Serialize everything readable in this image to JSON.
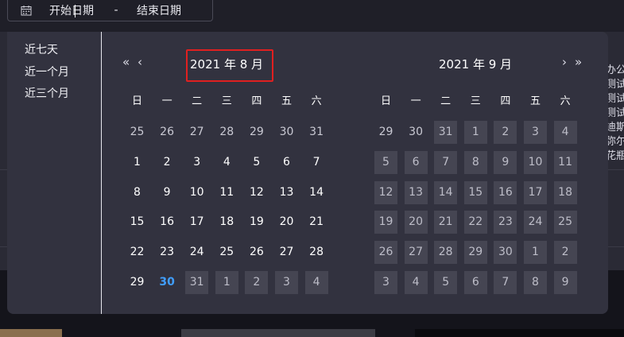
{
  "range_input": {
    "start_placeholder": "开始日期",
    "separator": "-",
    "end_placeholder": "结束日期",
    "icon": "calendar-icon"
  },
  "shortcuts": [
    "近七天",
    "近一个月",
    "近三个月"
  ],
  "weekdays": [
    "日",
    "一",
    "二",
    "三",
    "四",
    "五",
    "六"
  ],
  "left_month": {
    "title": "2021 年 8 月",
    "prev_year_icon": "«",
    "prev_month_icon": "‹",
    "weeks": [
      [
        {
          "d": "25",
          "t": "other"
        },
        {
          "d": "26",
          "t": "other"
        },
        {
          "d": "27",
          "t": "other"
        },
        {
          "d": "28",
          "t": "other"
        },
        {
          "d": "29",
          "t": "other"
        },
        {
          "d": "30",
          "t": "other"
        },
        {
          "d": "31",
          "t": "other"
        }
      ],
      [
        {
          "d": "1",
          "t": "cur"
        },
        {
          "d": "2",
          "t": "cur"
        },
        {
          "d": "3",
          "t": "cur"
        },
        {
          "d": "4",
          "t": "cur"
        },
        {
          "d": "5",
          "t": "cur"
        },
        {
          "d": "6",
          "t": "cur"
        },
        {
          "d": "7",
          "t": "cur"
        }
      ],
      [
        {
          "d": "8",
          "t": "cur"
        },
        {
          "d": "9",
          "t": "cur"
        },
        {
          "d": "10",
          "t": "cur"
        },
        {
          "d": "11",
          "t": "cur"
        },
        {
          "d": "12",
          "t": "cur"
        },
        {
          "d": "13",
          "t": "cur"
        },
        {
          "d": "14",
          "t": "cur"
        }
      ],
      [
        {
          "d": "15",
          "t": "cur"
        },
        {
          "d": "16",
          "t": "cur"
        },
        {
          "d": "17",
          "t": "cur"
        },
        {
          "d": "18",
          "t": "cur"
        },
        {
          "d": "19",
          "t": "cur"
        },
        {
          "d": "20",
          "t": "cur"
        },
        {
          "d": "21",
          "t": "cur"
        }
      ],
      [
        {
          "d": "22",
          "t": "cur"
        },
        {
          "d": "23",
          "t": "cur"
        },
        {
          "d": "24",
          "t": "cur"
        },
        {
          "d": "25",
          "t": "cur"
        },
        {
          "d": "26",
          "t": "cur"
        },
        {
          "d": "27",
          "t": "cur"
        },
        {
          "d": "28",
          "t": "cur"
        }
      ],
      [
        {
          "d": "29",
          "t": "cur"
        },
        {
          "d": "30",
          "t": "today"
        },
        {
          "d": "31",
          "t": "disabled"
        },
        {
          "d": "1",
          "t": "disabled"
        },
        {
          "d": "2",
          "t": "disabled"
        },
        {
          "d": "3",
          "t": "disabled"
        },
        {
          "d": "4",
          "t": "disabled"
        }
      ]
    ]
  },
  "right_month": {
    "title": "2021 年 9 月",
    "next_month_icon": "›",
    "next_year_icon": "»",
    "weeks": [
      [
        {
          "d": "29",
          "t": "other"
        },
        {
          "d": "30",
          "t": "other"
        },
        {
          "d": "31",
          "t": "disabled"
        },
        {
          "d": "1",
          "t": "disabled"
        },
        {
          "d": "2",
          "t": "disabled"
        },
        {
          "d": "3",
          "t": "disabled"
        },
        {
          "d": "4",
          "t": "disabled"
        }
      ],
      [
        {
          "d": "5",
          "t": "disabled"
        },
        {
          "d": "6",
          "t": "disabled"
        },
        {
          "d": "7",
          "t": "disabled"
        },
        {
          "d": "8",
          "t": "disabled"
        },
        {
          "d": "9",
          "t": "disabled"
        },
        {
          "d": "10",
          "t": "disabled"
        },
        {
          "d": "11",
          "t": "disabled"
        }
      ],
      [
        {
          "d": "12",
          "t": "disabled"
        },
        {
          "d": "13",
          "t": "disabled"
        },
        {
          "d": "14",
          "t": "disabled"
        },
        {
          "d": "15",
          "t": "disabled"
        },
        {
          "d": "16",
          "t": "disabled"
        },
        {
          "d": "17",
          "t": "disabled"
        },
        {
          "d": "18",
          "t": "disabled"
        }
      ],
      [
        {
          "d": "19",
          "t": "disabled"
        },
        {
          "d": "20",
          "t": "disabled"
        },
        {
          "d": "21",
          "t": "disabled"
        },
        {
          "d": "22",
          "t": "disabled"
        },
        {
          "d": "23",
          "t": "disabled"
        },
        {
          "d": "24",
          "t": "disabled"
        },
        {
          "d": "25",
          "t": "disabled"
        }
      ],
      [
        {
          "d": "26",
          "t": "disabled"
        },
        {
          "d": "27",
          "t": "disabled"
        },
        {
          "d": "28",
          "t": "disabled"
        },
        {
          "d": "29",
          "t": "disabled"
        },
        {
          "d": "30",
          "t": "disabled"
        },
        {
          "d": "1",
          "t": "disabled"
        },
        {
          "d": "2",
          "t": "disabled"
        }
      ],
      [
        {
          "d": "3",
          "t": "disabled"
        },
        {
          "d": "4",
          "t": "disabled"
        },
        {
          "d": "5",
          "t": "disabled"
        },
        {
          "d": "6",
          "t": "disabled"
        },
        {
          "d": "7",
          "t": "disabled"
        },
        {
          "d": "8",
          "t": "disabled"
        },
        {
          "d": "9",
          "t": "disabled"
        }
      ]
    ]
  },
  "background_side_text": [
    "办公",
    "测试",
    "测试",
    "测试",
    "迪斯",
    "弥尔",
    "花瓶"
  ],
  "colors": {
    "today": "#409eff",
    "highlight_border": "#e02020",
    "panel_bg": "#32323f",
    "disabled_cell_bg": "#454552"
  }
}
